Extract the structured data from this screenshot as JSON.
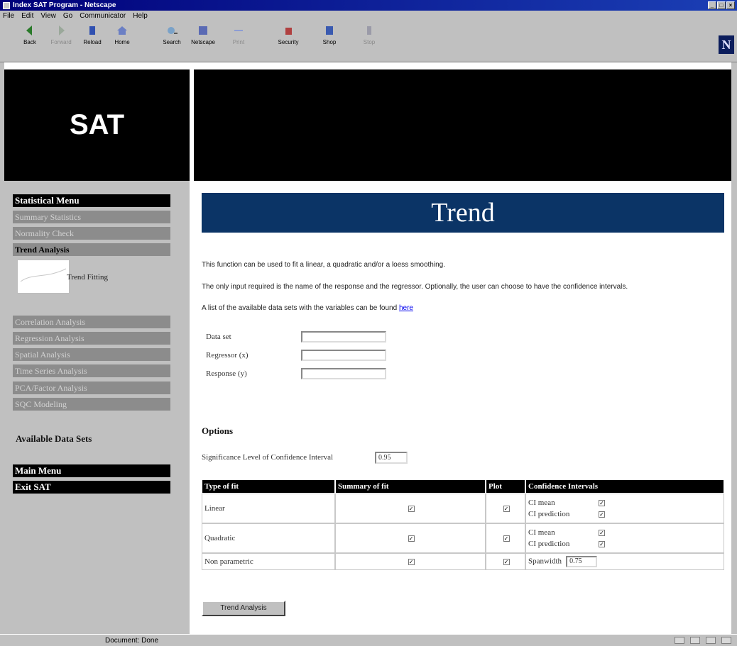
{
  "window": {
    "title": "Index SAT Program - Netscape"
  },
  "menu": [
    "File",
    "Edit",
    "View",
    "Go",
    "Communicator",
    "Help"
  ],
  "toolbar": [
    {
      "label": "Back",
      "icon": "back-arrow-icon",
      "enabled": true
    },
    {
      "label": "Forward",
      "icon": "forward-arrow-icon",
      "enabled": false
    },
    {
      "label": "Reload",
      "icon": "reload-icon",
      "enabled": true
    },
    {
      "label": "Home",
      "icon": "home-icon",
      "enabled": true
    },
    {
      "label": "Search",
      "icon": "search-icon",
      "enabled": true
    },
    {
      "label": "Netscape",
      "icon": "netscape-icon",
      "enabled": true
    },
    {
      "label": "Print",
      "icon": "print-icon",
      "enabled": false
    },
    {
      "label": "Security",
      "icon": "security-icon",
      "enabled": true
    },
    {
      "label": "Shop",
      "icon": "shop-icon",
      "enabled": true
    },
    {
      "label": "Stop",
      "icon": "stop-icon",
      "enabled": false
    }
  ],
  "brand": {
    "title": "SAT",
    "netscape_logo": "N"
  },
  "sidebar": {
    "header": "Statistical Menu",
    "items": [
      "Summary Statistics",
      "Normality Check",
      "Trend Analysis"
    ],
    "thumb_label": "Trend Fitting",
    "items2": [
      "Correlation Analysis",
      "Regression Analysis",
      "Spatial Analysis",
      "Time Series Analysis",
      "PCA/Factor Analysis",
      "SQC Modeling"
    ],
    "available": "Available Data Sets",
    "main_menu": "Main Menu",
    "exit": "Exit SAT"
  },
  "main": {
    "title": "Trend",
    "p1": "This function can be used to fit a linear, a quadratic and/or a loess smoothing.",
    "p2": "The only input required is the name of the response and the regressor. Optionally, the user can choose to have the confidence intervals.",
    "p3": "A list of the available data sets with the variables can be found ",
    "p3_link": "here",
    "fields": [
      {
        "label": "Data set",
        "value": ""
      },
      {
        "label": "Regressor (x)",
        "value": ""
      },
      {
        "label": "Response (y)",
        "value": ""
      }
    ],
    "options_title": "Options",
    "sig_label": "Significance Level of Confidence Interval",
    "sig_value": "0.95",
    "table": {
      "headers": [
        "Type of fit",
        "Summary of fit",
        "Plot",
        "Confidence Intervals"
      ],
      "rows": [
        {
          "type": "Linear",
          "summary": true,
          "plot": true,
          "ci": [
            [
              "CI mean",
              true
            ],
            [
              "CI prediction",
              true
            ]
          ]
        },
        {
          "type": "Quadratic",
          "summary": true,
          "plot": true,
          "ci": [
            [
              "CI mean",
              true
            ],
            [
              "CI prediction",
              true
            ]
          ]
        },
        {
          "type": "Non parametric",
          "summary": true,
          "plot": true,
          "span_label": "Spanwidth",
          "span_value": "0.75"
        }
      ]
    },
    "button": "Trend Analysis"
  },
  "status": {
    "text": "Document: Done"
  }
}
